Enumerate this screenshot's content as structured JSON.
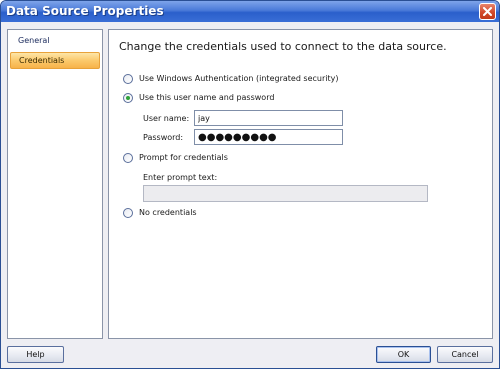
{
  "window": {
    "title": "Data Source Properties"
  },
  "nav": {
    "items": [
      {
        "label": "General",
        "selected": false
      },
      {
        "label": "Credentials",
        "selected": true
      }
    ]
  },
  "credentials": {
    "heading": "Change the credentials used to connect to the data source.",
    "options": [
      {
        "label": "Use Windows Authentication (integrated security)",
        "checked": false
      },
      {
        "label": "Use this user name and password",
        "checked": true
      },
      {
        "label": "Prompt for credentials",
        "checked": false
      },
      {
        "label": "No credentials",
        "checked": false
      }
    ],
    "username": {
      "label": "User name:",
      "value": "jay"
    },
    "password": {
      "label": "Password:",
      "value": "●●●●●●●●●"
    },
    "prompt": {
      "label": "Enter prompt text:",
      "value": ""
    }
  },
  "buttons": {
    "help": "Help",
    "ok": "OK",
    "cancel": "Cancel"
  },
  "colors": {
    "titlebar": "#2a5fcb",
    "selected_nav": "#fbc96c",
    "radio_dot": "#2fa33a"
  }
}
